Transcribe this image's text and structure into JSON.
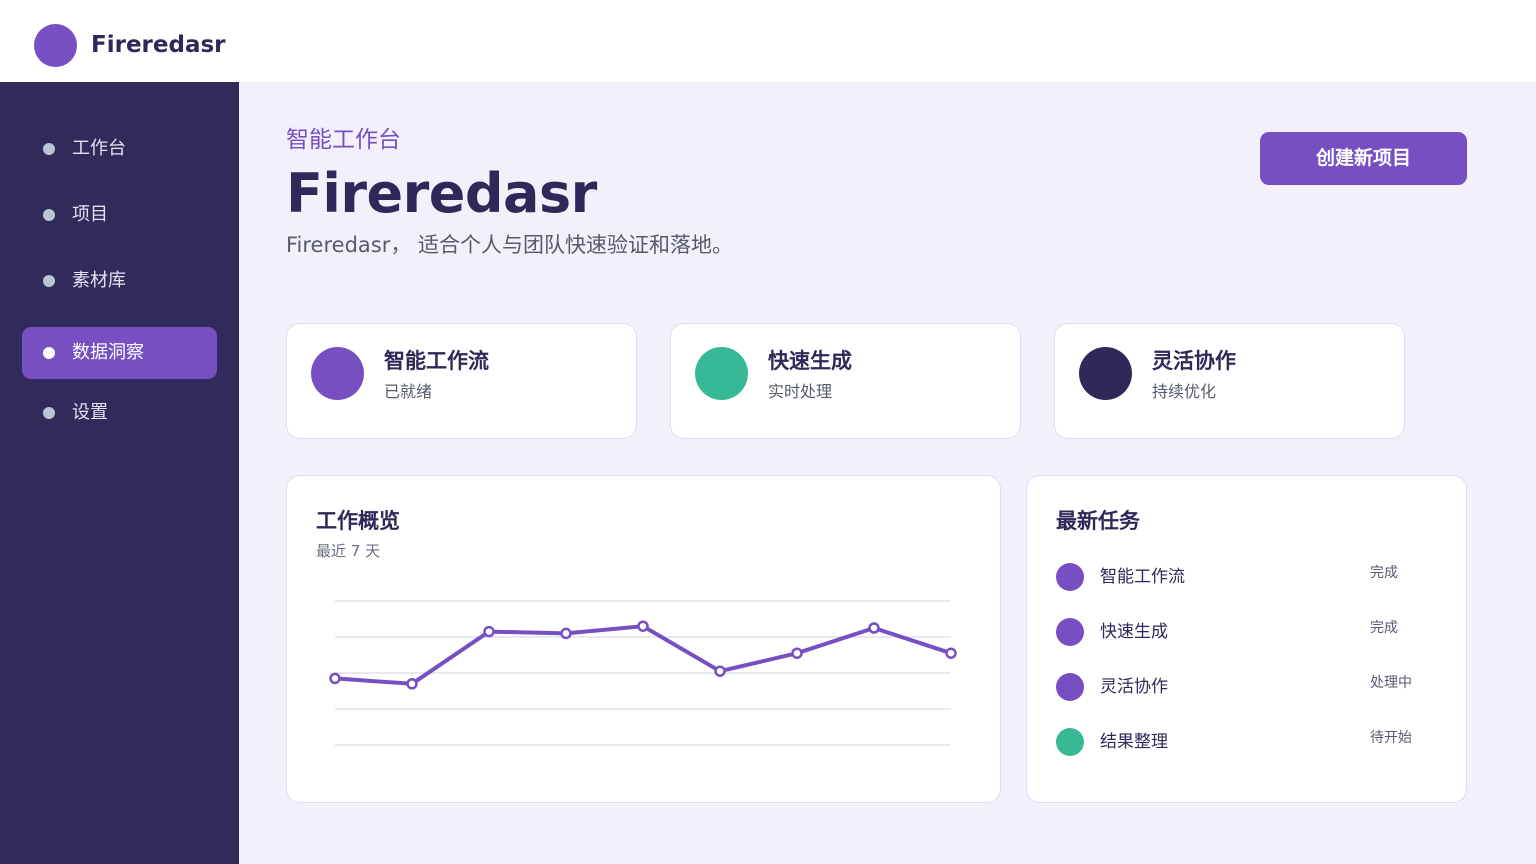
{
  "app": {
    "name": "Fireredasr"
  },
  "sidebar": {
    "items": [
      {
        "label": "工作台",
        "active": false
      },
      {
        "label": "项目",
        "active": false
      },
      {
        "label": "素材库",
        "active": false
      },
      {
        "label": "数据洞察",
        "active": true
      },
      {
        "label": "设置",
        "active": false
      }
    ]
  },
  "hero": {
    "eyebrow": "智能工作台",
    "title": "Fireredasr",
    "subtitle": "Fireredasr， 适合个人与团队快速验证和落地。",
    "cta_label": "创建新项目"
  },
  "features": [
    {
      "title": "智能工作流",
      "subtitle": "已就绪",
      "color": "#7650c2"
    },
    {
      "title": "快速生成",
      "subtitle": "实时处理",
      "color": "#38b995"
    },
    {
      "title": "灵活协作",
      "subtitle": "持续优化",
      "color": "#2f2858"
    }
  ],
  "overview": {
    "title": "工作概览",
    "subtitle": "最近 7 天"
  },
  "chart_data": {
    "type": "line",
    "x": [
      1,
      2,
      3,
      4,
      5,
      6,
      7,
      8,
      9
    ],
    "series": [
      {
        "values": [
          37,
          34,
          63,
          62,
          66,
          41,
          51,
          65,
          51
        ],
        "color": "#7650c2"
      }
    ],
    "ylim": [
      0,
      80
    ],
    "grid": true,
    "xlabel": "",
    "ylabel": ""
  },
  "tasks": {
    "title": "最新任务",
    "items": [
      {
        "name": "智能工作流",
        "status": "完成",
        "color": "#7650c2"
      },
      {
        "name": "快速生成",
        "status": "完成",
        "color": "#7650c2"
      },
      {
        "name": "灵活协作",
        "status": "处理中",
        "color": "#7650c2"
      },
      {
        "name": "结果整理",
        "status": "待开始",
        "color": "#38b995"
      }
    ]
  },
  "colors": {
    "accent": "#7650c2",
    "sidebar_bg": "#332a5c",
    "page_bg": "#f3f0fb",
    "success": "#38b995"
  }
}
